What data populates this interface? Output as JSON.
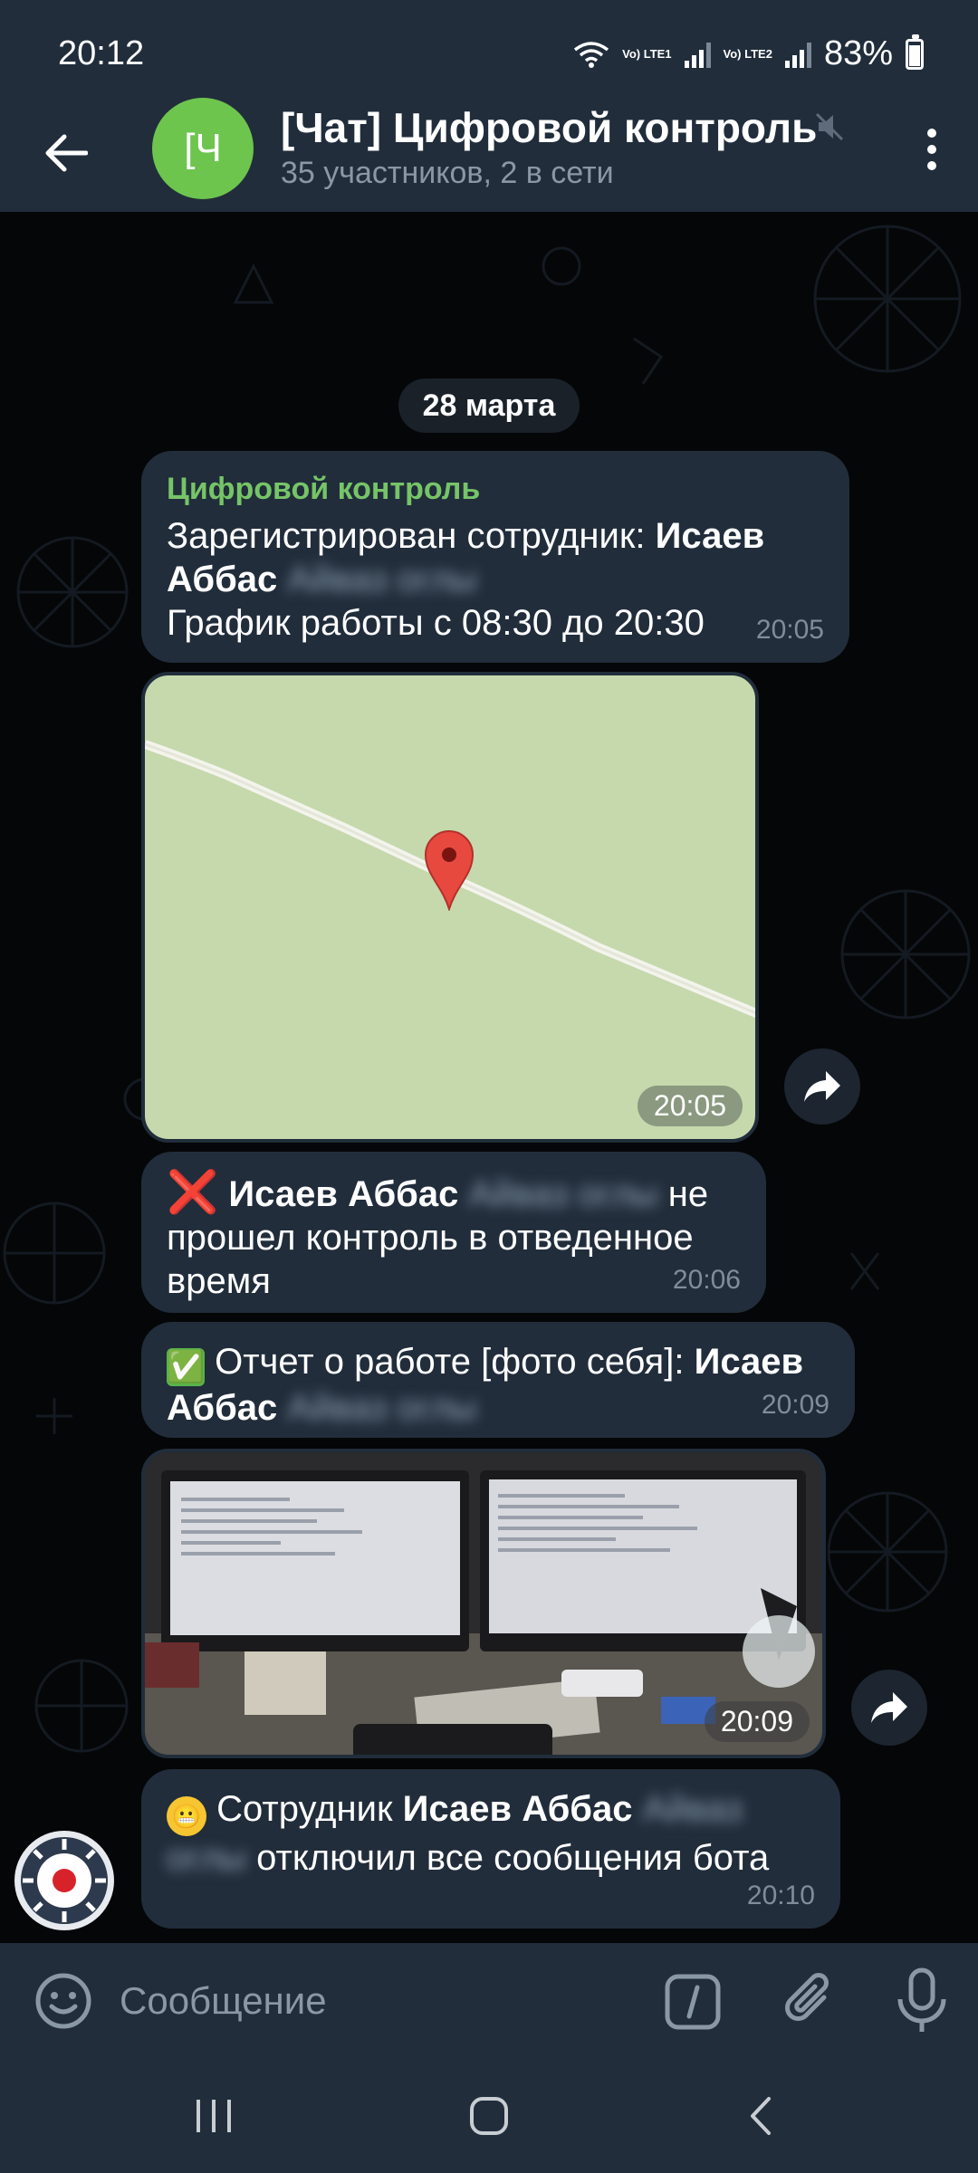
{
  "status_bar": {
    "time": "20:12",
    "sim1": "Vo) LTE1",
    "sim2": "Vo) LTE2",
    "battery": "83%"
  },
  "header": {
    "avatar_initial": "[Ч",
    "title": "[Чат] Цифровой контроль",
    "subtitle": "35 участников, 2 в сети",
    "avatar_color": "#6dc54e"
  },
  "chat": {
    "date": "28 марта",
    "messages": [
      {
        "sender": "Цифровой контроль",
        "text_prefix": "Зарегистрирован сотрудник: ",
        "name": "Исаев Аббас",
        "blurred": "Айваз оглы",
        "line2": "График работы с 08:30 до 20:30",
        "time": "20:05"
      },
      {
        "type": "location",
        "time": "20:05"
      },
      {
        "emoji": "❌",
        "name": "Исаев Аббас",
        "blurred": "Айваз оглы",
        "text": "не прошел контроль в отведенное время",
        "time": "20:06"
      },
      {
        "emoji": "✅",
        "text_prefix": "Отчет о работе [фото себя]: ",
        "name": "Исаев Аббас",
        "blurred": "Айваз оглы",
        "time": "20:09"
      },
      {
        "type": "photo",
        "time": "20:09"
      },
      {
        "emoji": "😬",
        "text_prefix": "Сотрудник ",
        "name": "Исаев Аббас",
        "blurred": "Айваз оглы",
        "text_suffix": "отключил все сообщения бота",
        "time": "20:10"
      }
    ]
  },
  "input": {
    "placeholder": "Сообщение"
  },
  "colors": {
    "bar_bg": "#212d3b",
    "bubble_bg": "#212d3b",
    "sender_green": "#76c467",
    "map_green": "#c5d9ad"
  }
}
